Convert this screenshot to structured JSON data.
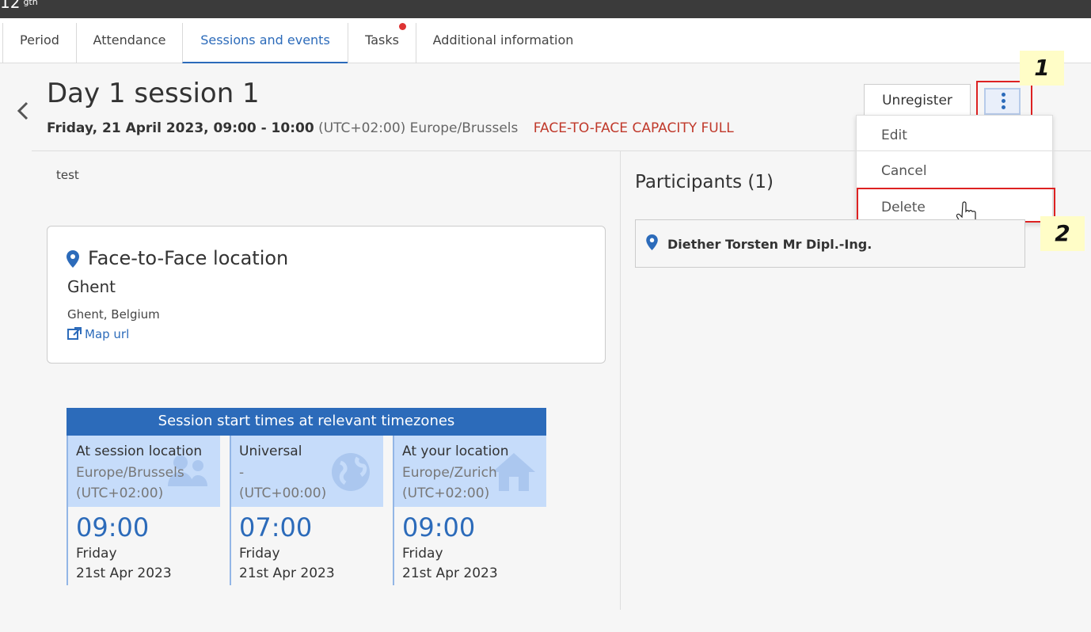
{
  "topbar": {
    "crumb": "12",
    "crumb_sup": "gth"
  },
  "tabs": [
    {
      "label": "Period"
    },
    {
      "label": "Attendance"
    },
    {
      "label": "Sessions and events"
    },
    {
      "label": "Tasks"
    },
    {
      "label": "Additional information"
    }
  ],
  "session": {
    "title": "Day 1 session 1",
    "datetime": "Friday, 21 April 2023, 09:00 - 10:00",
    "timezone": "(UTC+02:00) Europe/Brussels",
    "capacity_status": "FACE-TO-FACE CAPACITY FULL",
    "description": "test"
  },
  "actions": {
    "unregister_label": "Unregister",
    "menu": [
      {
        "label": "Edit"
      },
      {
        "label": "Cancel"
      },
      {
        "label": "Delete"
      }
    ]
  },
  "annotations": {
    "note1": "1",
    "note2": "2"
  },
  "location": {
    "heading": "Face-to-Face location",
    "city": "Ghent",
    "address": "Ghent, Belgium",
    "map_link": "Map url"
  },
  "timezones": {
    "heading": "Session start times at relevant timezones",
    "columns": [
      {
        "label": "At session location",
        "zone": "Europe/Brussels",
        "offset": "(UTC+02:00)",
        "time": "09:00",
        "day": "Friday",
        "date": "21st Apr 2023",
        "icon": "users-icon"
      },
      {
        "label": "Universal",
        "zone": "-",
        "offset": "(UTC+00:00)",
        "time": "07:00",
        "day": "Friday",
        "date": "21st Apr 2023",
        "icon": "globe-icon"
      },
      {
        "label": "At your location",
        "zone": "Europe/Zurich",
        "offset": "(UTC+02:00)",
        "time": "09:00",
        "day": "Friday",
        "date": "21st Apr 2023",
        "icon": "home-icon"
      }
    ]
  },
  "participants": {
    "title": "Participants (1)",
    "items": [
      {
        "name": "Diether Torsten Mr Dipl.-Ing."
      }
    ]
  },
  "colors": {
    "accent": "#2c6bba",
    "danger": "#c0392b",
    "highlight_box": "#dd2222",
    "note_bg": "#fffdc7"
  }
}
